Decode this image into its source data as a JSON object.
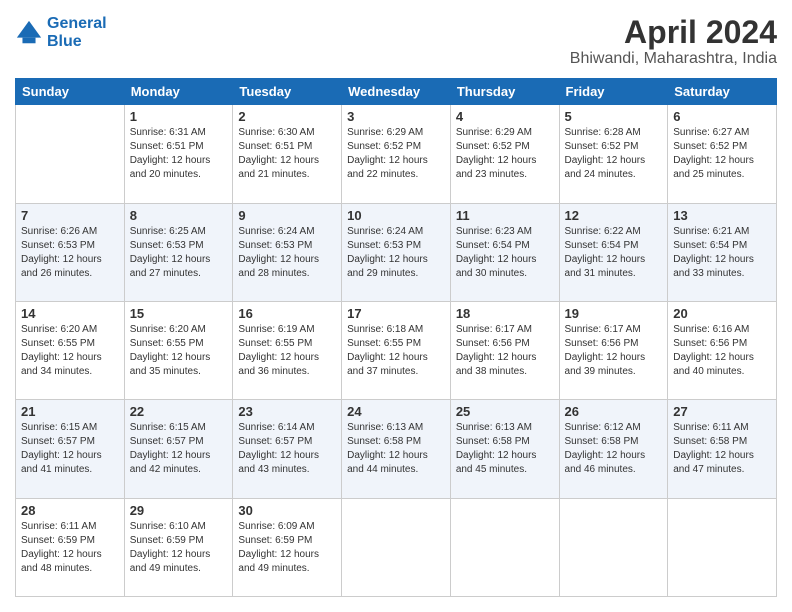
{
  "logo": {
    "line1": "General",
    "line2": "Blue"
  },
  "title": "April 2024",
  "subtitle": "Bhiwandi, Maharashtra, India",
  "days": [
    "Sunday",
    "Monday",
    "Tuesday",
    "Wednesday",
    "Thursday",
    "Friday",
    "Saturday"
  ],
  "weeks": [
    [
      {
        "num": "",
        "info": ""
      },
      {
        "num": "1",
        "info": "Sunrise: 6:31 AM\nSunset: 6:51 PM\nDaylight: 12 hours\nand 20 minutes."
      },
      {
        "num": "2",
        "info": "Sunrise: 6:30 AM\nSunset: 6:51 PM\nDaylight: 12 hours\nand 21 minutes."
      },
      {
        "num": "3",
        "info": "Sunrise: 6:29 AM\nSunset: 6:52 PM\nDaylight: 12 hours\nand 22 minutes."
      },
      {
        "num": "4",
        "info": "Sunrise: 6:29 AM\nSunset: 6:52 PM\nDaylight: 12 hours\nand 23 minutes."
      },
      {
        "num": "5",
        "info": "Sunrise: 6:28 AM\nSunset: 6:52 PM\nDaylight: 12 hours\nand 24 minutes."
      },
      {
        "num": "6",
        "info": "Sunrise: 6:27 AM\nSunset: 6:52 PM\nDaylight: 12 hours\nand 25 minutes."
      }
    ],
    [
      {
        "num": "7",
        "info": "Sunrise: 6:26 AM\nSunset: 6:53 PM\nDaylight: 12 hours\nand 26 minutes."
      },
      {
        "num": "8",
        "info": "Sunrise: 6:25 AM\nSunset: 6:53 PM\nDaylight: 12 hours\nand 27 minutes."
      },
      {
        "num": "9",
        "info": "Sunrise: 6:24 AM\nSunset: 6:53 PM\nDaylight: 12 hours\nand 28 minutes."
      },
      {
        "num": "10",
        "info": "Sunrise: 6:24 AM\nSunset: 6:53 PM\nDaylight: 12 hours\nand 29 minutes."
      },
      {
        "num": "11",
        "info": "Sunrise: 6:23 AM\nSunset: 6:54 PM\nDaylight: 12 hours\nand 30 minutes."
      },
      {
        "num": "12",
        "info": "Sunrise: 6:22 AM\nSunset: 6:54 PM\nDaylight: 12 hours\nand 31 minutes."
      },
      {
        "num": "13",
        "info": "Sunrise: 6:21 AM\nSunset: 6:54 PM\nDaylight: 12 hours\nand 33 minutes."
      }
    ],
    [
      {
        "num": "14",
        "info": "Sunrise: 6:20 AM\nSunset: 6:55 PM\nDaylight: 12 hours\nand 34 minutes."
      },
      {
        "num": "15",
        "info": "Sunrise: 6:20 AM\nSunset: 6:55 PM\nDaylight: 12 hours\nand 35 minutes."
      },
      {
        "num": "16",
        "info": "Sunrise: 6:19 AM\nSunset: 6:55 PM\nDaylight: 12 hours\nand 36 minutes."
      },
      {
        "num": "17",
        "info": "Sunrise: 6:18 AM\nSunset: 6:55 PM\nDaylight: 12 hours\nand 37 minutes."
      },
      {
        "num": "18",
        "info": "Sunrise: 6:17 AM\nSunset: 6:56 PM\nDaylight: 12 hours\nand 38 minutes."
      },
      {
        "num": "19",
        "info": "Sunrise: 6:17 AM\nSunset: 6:56 PM\nDaylight: 12 hours\nand 39 minutes."
      },
      {
        "num": "20",
        "info": "Sunrise: 6:16 AM\nSunset: 6:56 PM\nDaylight: 12 hours\nand 40 minutes."
      }
    ],
    [
      {
        "num": "21",
        "info": "Sunrise: 6:15 AM\nSunset: 6:57 PM\nDaylight: 12 hours\nand 41 minutes."
      },
      {
        "num": "22",
        "info": "Sunrise: 6:15 AM\nSunset: 6:57 PM\nDaylight: 12 hours\nand 42 minutes."
      },
      {
        "num": "23",
        "info": "Sunrise: 6:14 AM\nSunset: 6:57 PM\nDaylight: 12 hours\nand 43 minutes."
      },
      {
        "num": "24",
        "info": "Sunrise: 6:13 AM\nSunset: 6:58 PM\nDaylight: 12 hours\nand 44 minutes."
      },
      {
        "num": "25",
        "info": "Sunrise: 6:13 AM\nSunset: 6:58 PM\nDaylight: 12 hours\nand 45 minutes."
      },
      {
        "num": "26",
        "info": "Sunrise: 6:12 AM\nSunset: 6:58 PM\nDaylight: 12 hours\nand 46 minutes."
      },
      {
        "num": "27",
        "info": "Sunrise: 6:11 AM\nSunset: 6:58 PM\nDaylight: 12 hours\nand 47 minutes."
      }
    ],
    [
      {
        "num": "28",
        "info": "Sunrise: 6:11 AM\nSunset: 6:59 PM\nDaylight: 12 hours\nand 48 minutes."
      },
      {
        "num": "29",
        "info": "Sunrise: 6:10 AM\nSunset: 6:59 PM\nDaylight: 12 hours\nand 49 minutes."
      },
      {
        "num": "30",
        "info": "Sunrise: 6:09 AM\nSunset: 6:59 PM\nDaylight: 12 hours\nand 49 minutes."
      },
      {
        "num": "",
        "info": ""
      },
      {
        "num": "",
        "info": ""
      },
      {
        "num": "",
        "info": ""
      },
      {
        "num": "",
        "info": ""
      }
    ]
  ]
}
